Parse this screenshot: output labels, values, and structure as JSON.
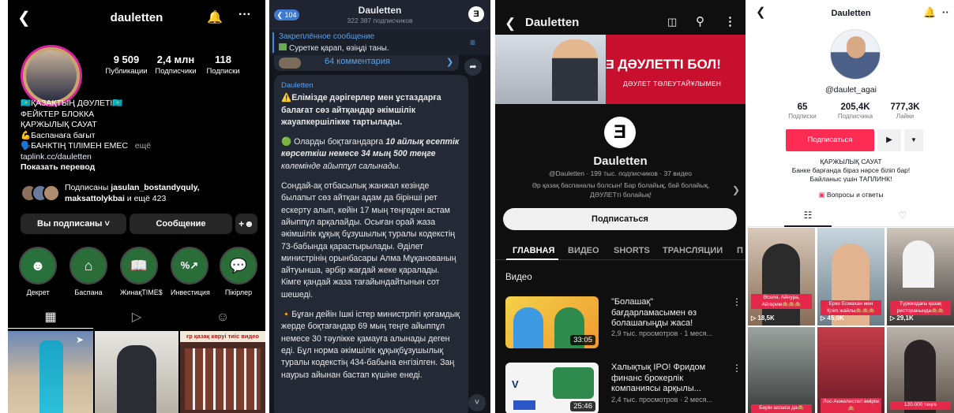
{
  "instagram": {
    "username": "dauletten",
    "stats": [
      {
        "value": "9 509",
        "label": "Публикации"
      },
      {
        "value": "2,4 млн",
        "label": "Подписчики"
      },
      {
        "value": "118",
        "label": "Подписки"
      }
    ],
    "bio_lines": [
      "🇰🇿ҚАЗАҚТЫҢ ДӘУЛЕТІ🇰🇿",
      "ФЕЙКТЕР БЛОККА",
      "ҚАРЖЫЛЫҚ САУАТ",
      "💪Баспанаға бағыт",
      "🗣️БАНКТІҢ ТІЛІМЕН ЕМЕС"
    ],
    "more": "ещё",
    "link": "taplink.cc/dauletten",
    "translate": "Показать перевод",
    "followed_by_prefix": "Подписаны ",
    "followed_by_names": "jasulan_bostandyquly, maksattolykbai",
    "followed_by_suffix": " и ещё 423",
    "following_button": "Вы подписаны",
    "message_button": "Сообщение",
    "highlights": [
      "Декрет",
      "Баспана",
      "ЖинақTIME$",
      "Инвестиция",
      "Пікірлер"
    ],
    "grid_caption": "ғр қазақ көруі тиіс видео"
  },
  "telegram": {
    "back_count": "104",
    "title": "Dauletten",
    "subtitle": "322 387 подписчиков",
    "pinned_label": "Закреплённое сообщение",
    "pinned_text": "Суретке қарап, өзіңді таны.",
    "comments": "64 комментария",
    "author": "Dauletten",
    "para1_lead": "⚠️Елімізде дәрігерлер мен ұстаздарға балағат сөз айтқандар әкімшілік жауапкершілікке тартылады.",
    "para2_lead": "🟢 Оларды боқтағандарға ",
    "para2_em": "10 айлық есептік көрсеткіш немесе 34 мың 500 теңге",
    "para2_tail": " көлемінде айыппұл салынады.",
    "para3": "Сондай-ақ отбасылық жанжал кезінде былапыт сөз айтқан адам да бірінші рет ескерту алып, кейін 17 мың теңгеден астам айыппұл арқалайды. Осыған орай жаза әкімшілік құқық бұзушылық туралы кодекстің 73-бабында қарастырылады. Әділет министрінің орынбасары Алма Мұқанованың айтуынша, әрбір жағдай жеке қаралады. Кімге қандай жаза тағайындайтынын сот шешеді.",
    "para4": "🔸Бұған дейін Ішкі істер министрлігі қоғамдық жерде боқтағандар 69 мың теңге айыппұл немесе 30 тәулікке қамауға алынады деген еді. Бұл норма әкімшілік құқықбұзушылық туралы кодекстің 434-бабына енгізілген. Заң наурыз айынан бастап күшіне енеді."
  },
  "youtube": {
    "title": "Dauletten",
    "banner_title": "ДӘУЛЕТТІ БОЛ!",
    "banner_sub": "ДӘУЛЕТ ТӨЛЕУТАЙҰЛЫМЕН",
    "channel_name": "Dauletten",
    "channel_meta": "@Dauletten · 199 тыс. подписчиков · 37 видео",
    "channel_desc": "Әр қазақ баспаналы болсын! Бар болайық, бай болайық, ДӘУЛЕТті болайық!",
    "subscribe": "Подписаться",
    "tabs": [
      "ГЛАВНАЯ",
      "ВИДЕО",
      "SHORTS",
      "ТРАНСЛЯЦИИ",
      "П"
    ],
    "section": "Видео",
    "videos": [
      {
        "title": "\"Болашақ\" бағдарламасымен өз болашағыңды жаса!",
        "meta": "2,9 тыс. просмотров · 1 меся...",
        "duration": "33:05"
      },
      {
        "title": "Халықтық IPO! Фридом финанс брокерлік компаниясы арқылы...",
        "meta": "2,4 тыс. просмотров · 2 меся...",
        "duration": "25:46"
      }
    ]
  },
  "tiktok": {
    "title": "Dauletten",
    "handle": "@daulet_agai",
    "stats": [
      {
        "value": "65",
        "label": "Подписки"
      },
      {
        "value": "205,4K",
        "label": "Подписчика"
      },
      {
        "value": "777,3K",
        "label": "Лайки"
      }
    ],
    "subscribe": "Подписаться",
    "bio": [
      "ҚАРЖЫЛЫҚ САУАТ",
      "Банке барғанда біраз нәрсе біліп бар!",
      "Байланыс үшін ТАПЛИНК!"
    ],
    "qa": "Вопросы и ответы",
    "videos": [
      {
        "caption": "Әселя, Айнура, Айгерим🙈🙈🙈",
        "views": "18,5K"
      },
      {
        "caption": "Ерке Есмахан мен Қоіm жайлы🙈🙈🙈",
        "views": "45,0K"
      },
      {
        "caption": "Түркиядағы қазақ ресторанында🙈🙈",
        "views": "29,1K"
      },
      {
        "caption": "Берін шошса да🙈",
        "views": ""
      },
      {
        "caption": "Лос-Анжелестегі өмірім🙈",
        "views": ""
      },
      {
        "caption": "120.000 теңге",
        "views": ""
      }
    ]
  }
}
